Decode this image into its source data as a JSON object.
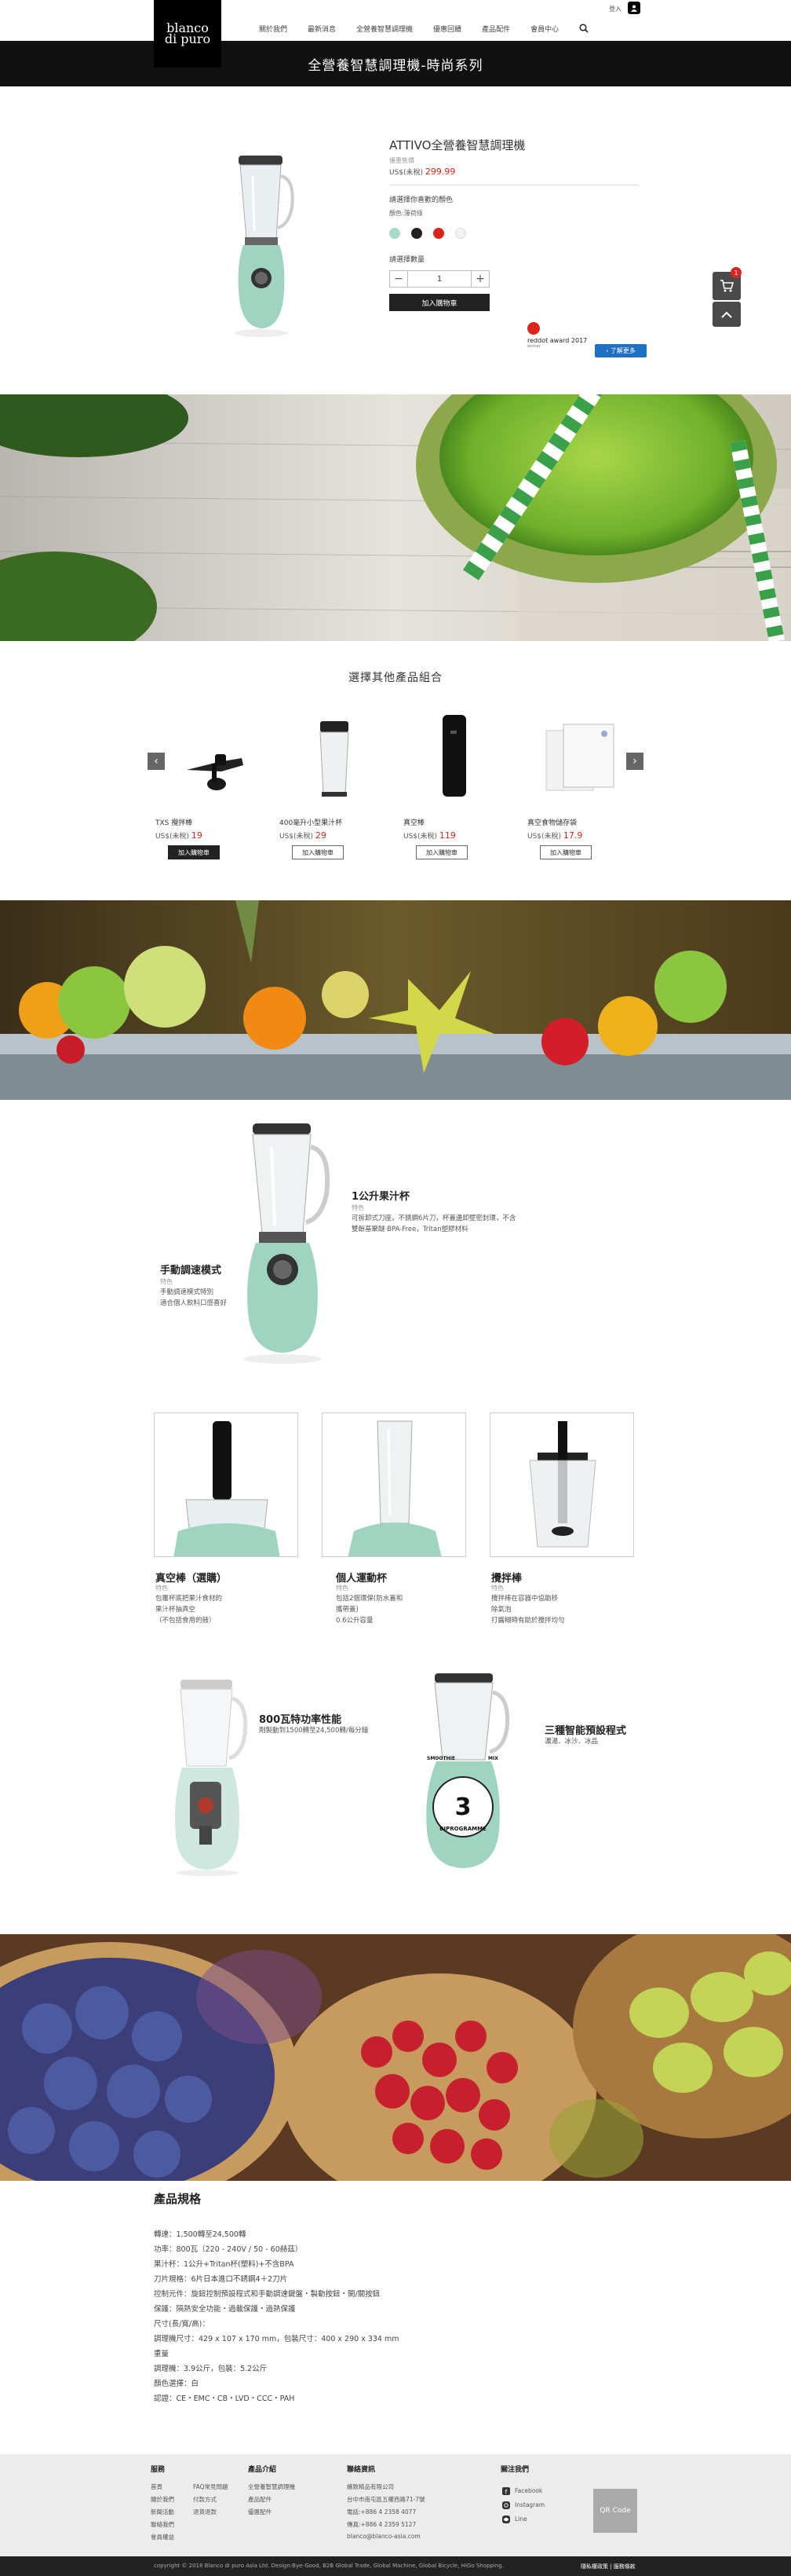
{
  "header": {
    "logo_line1": "blanco",
    "logo_line2": "di puro",
    "nav": [
      "關於我們",
      "最新消息",
      "全營養智慧調理機",
      "優惠回饋",
      "產品配件",
      "會員中心"
    ],
    "login": "登入"
  },
  "titlebar": "全營養智慧調理機-時尚系列",
  "product": {
    "name": "ATTIVO全營養智慧調理機",
    "sku": "優惠售價",
    "price_prefix": "US$(未稅) ",
    "price": "299.99",
    "color_prompt": "請選擇你喜歡的顏色",
    "color_label": "顏色:薄荷綠",
    "swatches": [
      "#a9d9c8",
      "#222222",
      "#d9251c",
      "#f2f2f2"
    ],
    "qty_label": "請選擇數量",
    "qty_value": "1",
    "minus": "−",
    "plus": "+",
    "add_to_cart": "加入購物車",
    "reddot_title": "reddot award 2017",
    "reddot_sub": "winner",
    "learn_more": "› 了解更多"
  },
  "float": {
    "cart_count": "1"
  },
  "recommend": {
    "title": "選擇其他產品組合",
    "prev": "‹",
    "next": "›",
    "items": [
      {
        "name": "TXS 攪拌棒",
        "price_prefix": "US$(未稅) ",
        "price": "19",
        "button": "加入購物車"
      },
      {
        "name": "400毫升小型果汁杯",
        "price_prefix": "US$(未稅) ",
        "price": "29",
        "button": "加入購物車"
      },
      {
        "name": "真空棒",
        "price_prefix": "US$(未稅) ",
        "price": "119",
        "button": "加入購物車"
      },
      {
        "name": "真空食物儲存袋",
        "price_prefix": "US$(未稅) ",
        "price": "17.9",
        "button": "加入購物車"
      }
    ]
  },
  "features": {
    "jar": {
      "title": "1公升果汁杯",
      "sub": "特色",
      "desc": [
        "可拆卸式刀座，不銹鋼6片刀，杯蓋邊卸壁密封環，不含",
        "雙酚基聚醚‧BPA-Free，Tritan塑膠材料"
      ]
    },
    "manual": {
      "title": "手動調速模式",
      "sub": "特色",
      "desc": [
        "手動調速模式特別",
        "適合個人飲料口感喜好"
      ]
    },
    "boxes": [
      {
        "title": "真空棒（選購）",
        "sub": "特色",
        "desc": [
          "包覆杯底把果汁食材的",
          "果汁杯抽真空",
          "（不包括食用的鼓）"
        ]
      },
      {
        "title": "個人運動杯",
        "sub": "特色",
        "desc": [
          "包括2個環保(防水蓋和",
          "攜帶蓋)",
          "0.6公升容量"
        ]
      },
      {
        "title": "攪拌棒",
        "sub": "特色",
        "desc": [
          "攪拌棒在容器中協助移",
          "除氣泡",
          "打醬糊時有助於攪拌均勻"
        ]
      }
    ],
    "motor": {
      "title": "800瓦特功率性能",
      "desc": "剛製動到1500轉至24,500轉/每分鐘"
    },
    "programs": {
      "title": "三種智能預設程式",
      "desc": "濃湯．冰沙．冰品",
      "badge_num": "3",
      "badge_text": "BIPROGRAMME",
      "label_left": "SMOOTHIE",
      "label_right": "MIX"
    }
  },
  "specs": {
    "title": "產品規格",
    "lines": [
      "轉速：1,500轉至24,500轉",
      "功率：800瓦（220 - 240V / 50 - 60赫茲）",
      "果汁杯：1公升+Tritan杯(塑料)+不含BPA",
      "刀片規格：6片日本進口不銹鋼4＋2刀片",
      "控制元件：旋鈕控制預設程式和手動調速鍵盤・製動按鈕・開/關按鈕",
      "保護：隔熱安全功能・過載保護・過熱保護",
      "尺寸(長/寬/高)：",
      "調理機尺寸：429 x 107 x 170 mm，包裝尺寸：400 x 290 x 334 mm",
      "重量",
      "調理機：3.9公斤，包裝：5.2公斤",
      "顏色選擇：白",
      "認證：CE・EMC・CB・LVD・CCC・PAH"
    ]
  },
  "footer": {
    "col1_title": "服務",
    "col1a": [
      "首頁",
      "關於我們",
      "新聞活動",
      "聯絡我們",
      "會員權益"
    ],
    "col1b": [
      "FAQ常見問題",
      "付款方式",
      "退貨退款"
    ],
    "col2_title": "產品介紹",
    "col2": [
      "全營養智慧調理機",
      "產品配件",
      "優惠配件"
    ],
    "col3_title": "聯絡資訊",
    "col3": [
      "繽致精品有限公司",
      "台中市南屯區五權西路71-7號",
      "電話:+886 4 2358 4077",
      "傳真:+886 4 2359 5127",
      "blanco@blanco-asia.com"
    ],
    "col4_title": "關注我們",
    "col4": [
      "Facebook",
      "Instagram",
      "Line"
    ],
    "qr": "QR Code",
    "copyright": "copyright © 2018 Blanco di puro Asia Ltd. Design:Bye-Good, B2B Global Trade, Global Machine, Global Bicycle, HiGo Shopping.",
    "privacy": "隱私權政策 | 服務條款"
  }
}
